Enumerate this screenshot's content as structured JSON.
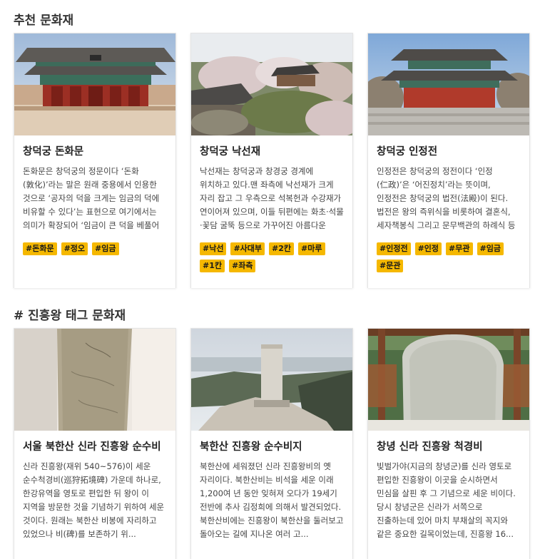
{
  "section1": {
    "title": "추천 문화재",
    "cards": [
      {
        "title": "창덕궁 돈화문",
        "desc": "돈화문은 창덕궁의 정문이다 ‘돈화(敦化)’라는 말은 원래 중용에서 인용한 것으로 ‘공자의 덕을 크게는 임금의 덕에 비유할 수 있다’는 표현으로 여기에서는 의미가 확장되어 ‘임금이 큰 덕을 베풀어 백성들을 돈독하게 교화 한다’는 ...",
        "tags": [
          "#돈화문",
          "#정오",
          "#임금"
        ]
      },
      {
        "title": "창덕궁 낙선재",
        "desc": "낙선재는 창덕궁과 창경궁 경계에 위치하고 있다.맨 좌측에 낙선재가 크게 자리 잡고 그 우측으로 석복헌과 수강재가 연이어져 있으며, 이들 뒤편에는 화초·석물·꽃담 굴뚝 등으로 가꾸어진 아름다운 화계와 그 위의 꽃담 너머로는 상...",
        "tags": [
          "#낙선",
          "#사대부",
          "#2칸",
          "#마루",
          "#1칸",
          "#좌측"
        ]
      },
      {
        "title": "창덕궁 인정전",
        "desc": "인정전은 창덕궁의 정전이다 ‘인정(仁政)’은 ‘어진정치’라는 뜻이며, 인정전은 창덕궁의 법전(法殿)이 된다. 법전은 왕의 즉위식을 비롯하여 결혼식, 세자책봉식 그리고 문무백관의 하례식 등 공식적인 국가 행사 때의 중요한 건물이다. ...",
        "tags": [
          "#인정전",
          "#인정",
          "#무관",
          "#임금",
          "#문관"
        ]
      }
    ]
  },
  "section2": {
    "title": "# 진흥왕 태그 문화재",
    "cards": [
      {
        "title": "서울 북한산 신라 진흥왕 순수비",
        "desc": "신라 진흥왕(재위 540~576)이 세운 순수척경비(巡狩拓境碑) 가운데 하나로, 한강유역을 영토로 편입한 뒤 왕이 이 지역을 방문한 것을 기념하기 위하여 세운 것이다. 원래는 북한산 비봉에 자리하고 있었으나 비(碑)를 보존하기 위..."
      },
      {
        "title": "북한산 진흥왕 순수비지",
        "desc": "북한산에 세워졌던 신라 진흥왕비의 옛 자리이다. 북한산비는 비석을 세운 이래 1,200여 년 동안 잊혀져 오다가 19세기 전반에 추사 김정희에 의해서 발견되었다. 북한산비에는 진흥왕이 북한산을 둘러보고 돌아오는 길에 지나온 여러 고..."
      },
      {
        "title": "창녕 신라 진흥왕 척경비",
        "desc": "빛벌가야(지금의 창녕군)를 신라 영토로 편입한 진흥왕이 이곳을 순시하면서 민심을 살핀 후 그 기념으로 세운 비이다. 당시 창녕군은 신라가 서쪽으로 진출하는데 있어 마치 부채살의 꼭지와 같은 중요한 길목이었는데, 진흥왕 16..."
      }
    ]
  },
  "colors": {
    "tag_bg": "#f5b800",
    "title": "#333333",
    "text": "#444444"
  }
}
